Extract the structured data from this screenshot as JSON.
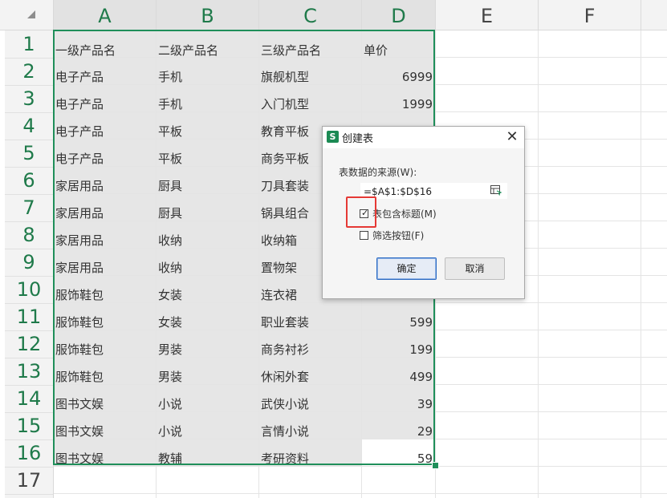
{
  "columns": [
    "A",
    "B",
    "C",
    "D",
    "E",
    "F"
  ],
  "rows": [
    "1",
    "2",
    "3",
    "4",
    "5",
    "6",
    "7",
    "8",
    "9",
    "10",
    "11",
    "12",
    "13",
    "14",
    "15",
    "16",
    "17"
  ],
  "table": {
    "header": [
      "一级产品名",
      "二级产品名",
      "三级产品名",
      "单价"
    ],
    "body": [
      [
        "电子产品",
        "手机",
        "旗舰机型",
        "6999"
      ],
      [
        "电子产品",
        "手机",
        "入门机型",
        "1999"
      ],
      [
        "电子产品",
        "平板",
        "教育平板",
        ""
      ],
      [
        "电子产品",
        "平板",
        "商务平板",
        ""
      ],
      [
        "家居用品",
        "厨具",
        "刀具套装",
        ""
      ],
      [
        "家居用品",
        "厨具",
        "锅具组合",
        ""
      ],
      [
        "家居用品",
        "收纳",
        "收纳箱",
        ""
      ],
      [
        "家居用品",
        "收纳",
        "置物架",
        ""
      ],
      [
        "服饰鞋包",
        "女装",
        "连衣裙",
        ""
      ],
      [
        "服饰鞋包",
        "女装",
        "职业套装",
        "599"
      ],
      [
        "服饰鞋包",
        "男装",
        "商务衬衫",
        "199"
      ],
      [
        "服饰鞋包",
        "男装",
        "休闲外套",
        "499"
      ],
      [
        "图书文娱",
        "小说",
        "武侠小说",
        "39"
      ],
      [
        "图书文娱",
        "小说",
        "言情小说",
        "29"
      ],
      [
        "图书文娱",
        "教辅",
        "考研资料",
        "59"
      ]
    ]
  },
  "dialog": {
    "app_icon": "S",
    "title": "创建表",
    "close_glyph": "✕",
    "source_label": "表数据的来源(W):",
    "source_value": "=$A$1:$D$16",
    "has_headers_label": "表包含标题(M)",
    "has_headers_checked": true,
    "filter_buttons_label": "筛选按钮(F)",
    "filter_buttons_checked": false,
    "ok_label": "确定",
    "cancel_label": "取消"
  },
  "colors": {
    "selection_border": "#1f8f5a",
    "highlight_box": "#e53935",
    "primary_button_border": "#2d6cc4"
  }
}
